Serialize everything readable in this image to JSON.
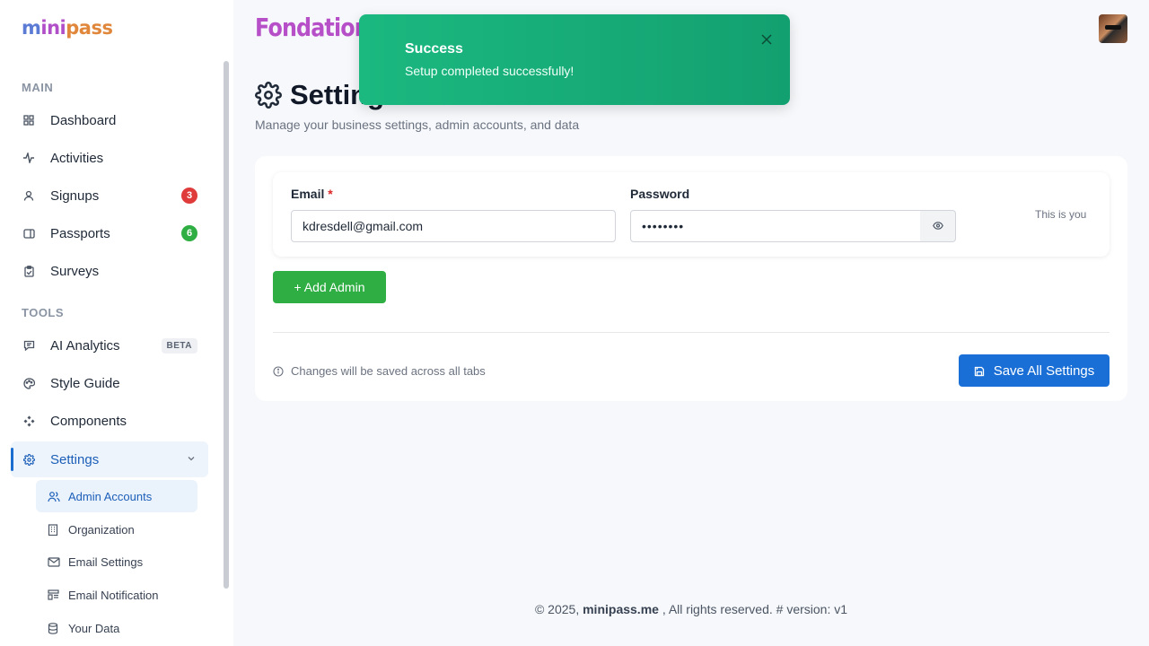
{
  "logo": {
    "part1": "m",
    "part2": "ini",
    "part3": "pass"
  },
  "brand": {
    "title": "Fondation"
  },
  "sidebar": {
    "sections": {
      "main": "MAIN",
      "tools": "TOOLS"
    },
    "items": [
      {
        "label": "Dashboard",
        "icon": "grid-icon"
      },
      {
        "label": "Activities",
        "icon": "activity-icon"
      },
      {
        "label": "Signups",
        "icon": "user-icon",
        "badge": "3",
        "badge_color": "#e03b3b"
      },
      {
        "label": "Passports",
        "icon": "ticket-icon",
        "badge": "6",
        "badge_color": "#2fae43"
      },
      {
        "label": "Surveys",
        "icon": "clipboard-icon"
      },
      {
        "label": "AI Analytics",
        "icon": "chat-icon",
        "tag": "BETA"
      },
      {
        "label": "Style Guide",
        "icon": "palette-icon"
      },
      {
        "label": "Components",
        "icon": "components-icon"
      },
      {
        "label": "Settings",
        "icon": "gear-icon"
      }
    ],
    "sub_items": [
      {
        "label": "Admin Accounts",
        "icon": "users-icon"
      },
      {
        "label": "Organization",
        "icon": "building-icon"
      },
      {
        "label": "Email Settings",
        "icon": "mail-icon"
      },
      {
        "label": "Email Notification",
        "icon": "template-icon"
      },
      {
        "label": "Your Data",
        "icon": "database-icon"
      }
    ]
  },
  "page": {
    "title": "Settings",
    "subtitle": "Manage your business settings, admin accounts, and data"
  },
  "admin": {
    "email_label": "Email",
    "required_mark": "*",
    "email_value": "kdresdell@gmail.com",
    "password_label": "Password",
    "password_value": "••••••••",
    "self_note": "This is you"
  },
  "actions": {
    "add_admin": "+ Add Admin",
    "save_note": "Changes will be saved across all tabs",
    "save_all": "Save All Settings"
  },
  "footer": {
    "prefix": "© 2025, ",
    "site": "minipass.me",
    "suffix": " , All rights reserved. # version: v1"
  },
  "toast": {
    "title": "Success",
    "message": "Setup completed successfully!",
    "color": "#1bb880"
  },
  "colors": {
    "accent": "#1a6fd6",
    "success": "#2fae43",
    "danger": "#e03b3b",
    "brand": "#b64fc8"
  }
}
